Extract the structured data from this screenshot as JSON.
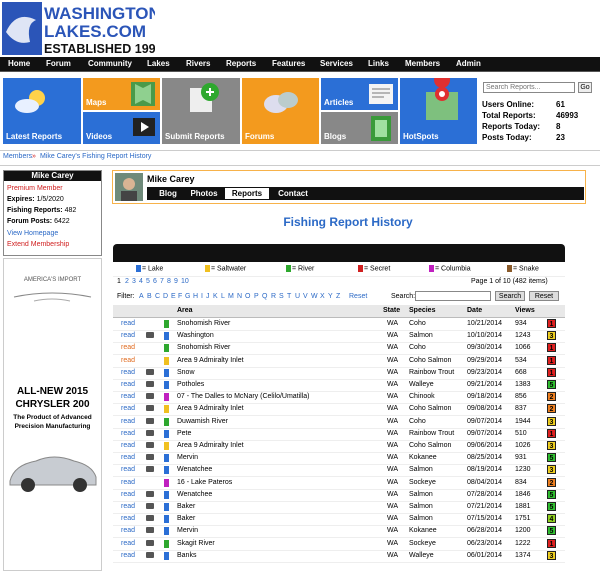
{
  "logo": {
    "line1": "WASHINGTON",
    "line2": "LAKES.COM",
    "line3": "ESTABLISHED 1997"
  },
  "nav": [
    "Home",
    "Forum",
    "Community",
    "Lakes",
    "Rivers",
    "Reports",
    "Features",
    "Services",
    "Links",
    "Members",
    "Admin"
  ],
  "tiles": {
    "latest": "Latest Reports",
    "maps": "Maps",
    "videos": "Videos",
    "submit": "Submit Reports",
    "forums": "Forums",
    "articles": "Articles",
    "blogs": "Blogs",
    "hotspots": "HotSpots"
  },
  "stats": {
    "search_placeholder": "Search Reports...",
    "go": "Go",
    "users_online_label": "Users Online:",
    "users_online": "61",
    "total_reports_label": "Total Reports:",
    "total_reports": "46993",
    "reports_today_label": "Reports Today:",
    "reports_today": "8",
    "posts_today_label": "Posts Today:",
    "posts_today": "23"
  },
  "breadcrumb": {
    "members": "Members",
    "sep": "»",
    "current": "Mike Carey's Fishing Report History"
  },
  "member": {
    "name": "Mike Carey",
    "role": "Premium Member",
    "expires_label": "Expires:",
    "expires": "1/5/2020",
    "reports_label": "Fishing Reports:",
    "reports": "482",
    "posts_label": "Forum Posts:",
    "posts": "6422",
    "homepage": "View Homepage",
    "extend": "Extend Membership"
  },
  "ad": {
    "brand": "AMERICA'S IMPORT",
    "headline1": "ALL-NEW 2015",
    "headline2": "CHRYSLER 200",
    "sub1": "The Product of Advanced",
    "sub2": "Precision Manufacturing"
  },
  "profile_tabs": [
    "Blog",
    "Photos",
    "Reports",
    "Contact"
  ],
  "page_title": "Fishing Report History",
  "legend": [
    {
      "label": "= Lake",
      "color": "#2b6fd6"
    },
    {
      "label": "= Saltwater",
      "color": "#f0c020"
    },
    {
      "label": "= River",
      "color": "#2ea82e"
    },
    {
      "label": "= Secret",
      "color": "#d02020"
    },
    {
      "label": "= Columbia",
      "color": "#c020c0"
    },
    {
      "label": "= Snake",
      "color": "#8a5a2a"
    }
  ],
  "pager": {
    "pages": [
      "1",
      "2",
      "3",
      "4",
      "5",
      "6",
      "7",
      "8",
      "9",
      "10"
    ],
    "status": "Page 1 of 10 (482 items)"
  },
  "filter": {
    "label": "Filter:",
    "letters": [
      "A",
      "B",
      "C",
      "D",
      "E",
      "F",
      "G",
      "H",
      "I",
      "J",
      "K",
      "L",
      "M",
      "N",
      "O",
      "P",
      "Q",
      "R",
      "S",
      "T",
      "U",
      "V",
      "W",
      "X",
      "Y",
      "Z"
    ],
    "reset_link": "Reset",
    "search_label": "Search:",
    "search_btn": "Search",
    "reset_btn": "Reset"
  },
  "table": {
    "headers": [
      "Area",
      "State",
      "Species",
      "Date",
      "Views"
    ],
    "rows": [
      {
        "link": "read",
        "cam": false,
        "color": "#2ea82e",
        "area": "Snohomish River",
        "state": "WA",
        "species": "Coho",
        "date": "10/21/2014",
        "views": "934",
        "rating": "1",
        "rc": "#e02020"
      },
      {
        "link": "read",
        "cam": true,
        "color": "#2b6fd6",
        "area": "Washington",
        "state": "WA",
        "species": "Salmon",
        "date": "10/10/2014",
        "views": "1243",
        "rating": "3",
        "rc": "#f0d020"
      },
      {
        "link": "read",
        "cam": false,
        "color": "#2ea82e",
        "area": "Snohomish River",
        "state": "WA",
        "species": "Coho",
        "date": "09/30/2014",
        "views": "1066",
        "rating": "1",
        "rc": "#e02020"
      },
      {
        "link": "read",
        "cam": false,
        "color": "#f0c020",
        "area": "Area 9 Admiralty Inlet",
        "state": "WA",
        "species": "Coho Salmon",
        "date": "09/29/2014",
        "views": "534",
        "rating": "1",
        "rc": "#e02020"
      },
      {
        "link": "read",
        "cam": true,
        "color": "#2b6fd6",
        "area": "Snow",
        "state": "WA",
        "species": "Rainbow Trout",
        "date": "09/23/2014",
        "views": "668",
        "rating": "1",
        "rc": "#e02020"
      },
      {
        "link": "read",
        "cam": true,
        "color": "#2b6fd6",
        "area": "Potholes",
        "state": "WA",
        "species": "Walleye",
        "date": "09/21/2014",
        "views": "1383",
        "rating": "5",
        "rc": "#30c030"
      },
      {
        "link": "read",
        "cam": true,
        "color": "#c020c0",
        "area": "07 - The Dalles to McNary (Celilo/Umatilla)",
        "state": "WA",
        "species": "Chinook",
        "date": "09/18/2014",
        "views": "856",
        "rating": "2",
        "rc": "#f08020"
      },
      {
        "link": "read",
        "cam": true,
        "color": "#f0c020",
        "area": "Area 9 Admiralty Inlet",
        "state": "WA",
        "species": "Coho Salmon",
        "date": "09/08/2014",
        "views": "837",
        "rating": "2",
        "rc": "#f08020"
      },
      {
        "link": "read",
        "cam": true,
        "color": "#2ea82e",
        "area": "Duwamish River",
        "state": "WA",
        "species": "Coho",
        "date": "09/07/2014",
        "views": "1944",
        "rating": "3",
        "rc": "#f0d020"
      },
      {
        "link": "read",
        "cam": true,
        "color": "#2b6fd6",
        "area": "Pete",
        "state": "WA",
        "species": "Rainbow Trout",
        "date": "09/07/2014",
        "views": "510",
        "rating": "1",
        "rc": "#e02020"
      },
      {
        "link": "read",
        "cam": true,
        "color": "#f0c020",
        "area": "Area 9 Admiralty Inlet",
        "state": "WA",
        "species": "Coho Salmon",
        "date": "09/06/2014",
        "views": "1026",
        "rating": "3",
        "rc": "#f0d020"
      },
      {
        "link": "read",
        "cam": true,
        "color": "#2b6fd6",
        "area": "Mervin",
        "state": "WA",
        "species": "Kokanee",
        "date": "08/25/2014",
        "views": "931",
        "rating": "5",
        "rc": "#30c030"
      },
      {
        "link": "read",
        "cam": true,
        "color": "#2b6fd6",
        "area": "Wenatchee",
        "state": "WA",
        "species": "Salmon",
        "date": "08/19/2014",
        "views": "1230",
        "rating": "3",
        "rc": "#f0d020"
      },
      {
        "link": "read",
        "cam": false,
        "color": "#c020c0",
        "area": "16 - Lake Pateros",
        "state": "WA",
        "species": "Sockeye",
        "date": "08/04/2014",
        "views": "834",
        "rating": "2",
        "rc": "#f08020"
      },
      {
        "link": "read",
        "cam": true,
        "color": "#2b6fd6",
        "area": "Wenatchee",
        "state": "WA",
        "species": "Salmon",
        "date": "07/28/2014",
        "views": "1846",
        "rating": "5",
        "rc": "#30c030"
      },
      {
        "link": "read",
        "cam": true,
        "color": "#2b6fd6",
        "area": "Baker",
        "state": "WA",
        "species": "Salmon",
        "date": "07/21/2014",
        "views": "1881",
        "rating": "5",
        "rc": "#30c030"
      },
      {
        "link": "read",
        "cam": true,
        "color": "#2b6fd6",
        "area": "Baker",
        "state": "WA",
        "species": "Salmon",
        "date": "07/15/2014",
        "views": "1751",
        "rating": "4",
        "rc": "#90d020"
      },
      {
        "link": "read",
        "cam": true,
        "color": "#2b6fd6",
        "area": "Mervin",
        "state": "WA",
        "species": "Kokanee",
        "date": "06/28/2014",
        "views": "1200",
        "rating": "5",
        "rc": "#30c030"
      },
      {
        "link": "read",
        "cam": true,
        "color": "#2ea82e",
        "area": "Skagit River",
        "state": "WA",
        "species": "Sockeye",
        "date": "06/23/2014",
        "views": "1222",
        "rating": "1",
        "rc": "#e02020"
      },
      {
        "link": "read",
        "cam": true,
        "color": "#2b6fd6",
        "area": "Banks",
        "state": "WA",
        "species": "Walleye",
        "date": "06/01/2014",
        "views": "1374",
        "rating": "3",
        "rc": "#f0d020"
      }
    ]
  }
}
